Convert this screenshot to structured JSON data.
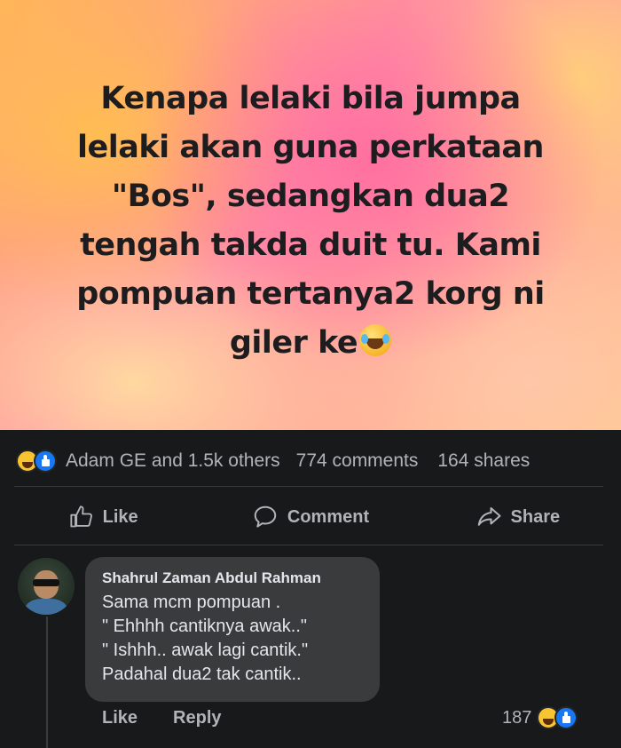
{
  "post": {
    "text_lines": [
      "Kenapa lelaki bila jumpa",
      "lelaki akan guna perkataan",
      "\"Bos\", sedangkan dua2",
      "tengah takda duit tu. Kami",
      "pompuan tertanya2 korg ni",
      "giler ke"
    ],
    "emoji": "laughing-tears-emoji"
  },
  "stats": {
    "reactions": [
      "haha-reaction-icon",
      "like-reaction-icon"
    ],
    "names": "Adam GE and 1.5k others",
    "comments": "774 comments",
    "shares": "164 shares"
  },
  "actions": {
    "like": "Like",
    "comment": "Comment",
    "share": "Share"
  },
  "comment": {
    "author": "Shahrul Zaman Abdul Rahman",
    "lines": [
      "Sama mcm pompuan .",
      "\" Ehhhh cantiknya awak..\"",
      "\" Ishhh.. awak lagi cantik.\"",
      "Padahal dua2 tak cantik.."
    ],
    "like_label": "Like",
    "reply_label": "Reply",
    "reaction_count": "187"
  },
  "colors": {
    "dark_bg": "#18191a",
    "bubble_bg": "#3a3b3c",
    "muted_text": "#b0b3b8",
    "text": "#e4e6eb",
    "like_blue": "#1877f2",
    "haha_yellow": "#f7c531"
  }
}
